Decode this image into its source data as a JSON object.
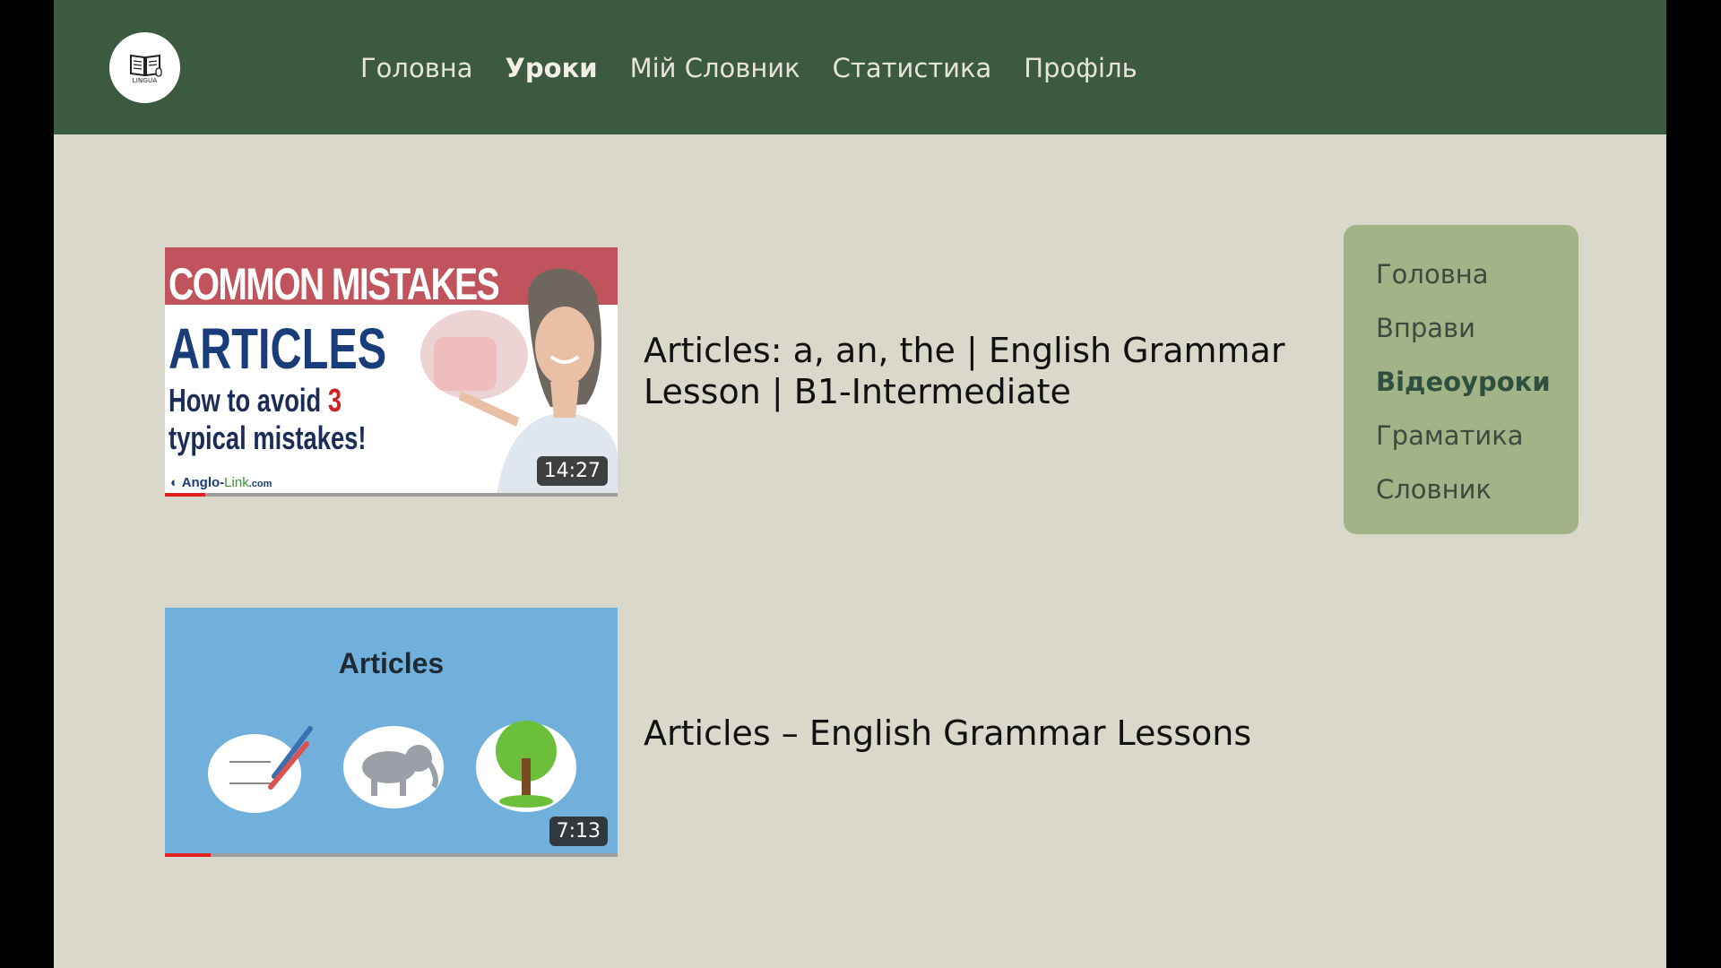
{
  "colors": {
    "header_bg": "#3b5a40",
    "page_bg": "#dad7cb",
    "sidebar_bg": "#a2b387",
    "active_sidebar_text": "#2f4f3f"
  },
  "logo": {
    "text": "LINGUA",
    "icon": "open-book-icon"
  },
  "nav": {
    "items": [
      {
        "label": "Головна"
      },
      {
        "label": "Уроки"
      },
      {
        "label": "Мій Словник"
      },
      {
        "label": "Статистика"
      },
      {
        "label": "Профіль"
      }
    ],
    "active": "Уроки"
  },
  "videos": [
    {
      "title": "Articles: a, an, the | English Grammar Lesson | B1-Intermediate",
      "duration": "14:27",
      "progress": 0.09,
      "thumbnail": {
        "banner": "COMMON MISTAKES",
        "headline": "ARTICLES",
        "subline_before": "How to avoid ",
        "subline_num": "3",
        "subline_after": "typical mistakes!",
        "brand_main": "Anglo-",
        "brand_accent": "Link",
        "brand_suffix": ".com"
      }
    },
    {
      "title": "Articles – English Grammar Lessons",
      "duration": "7:13",
      "progress": 0.1,
      "thumbnail": {
        "headline": "Articles"
      }
    }
  ],
  "sidebar": {
    "items": [
      {
        "label": "Головна"
      },
      {
        "label": "Вправи"
      },
      {
        "label": "Відеоуроки"
      },
      {
        "label": "Граматика"
      },
      {
        "label": "Словник"
      }
    ],
    "active": "Відеоуроки"
  }
}
